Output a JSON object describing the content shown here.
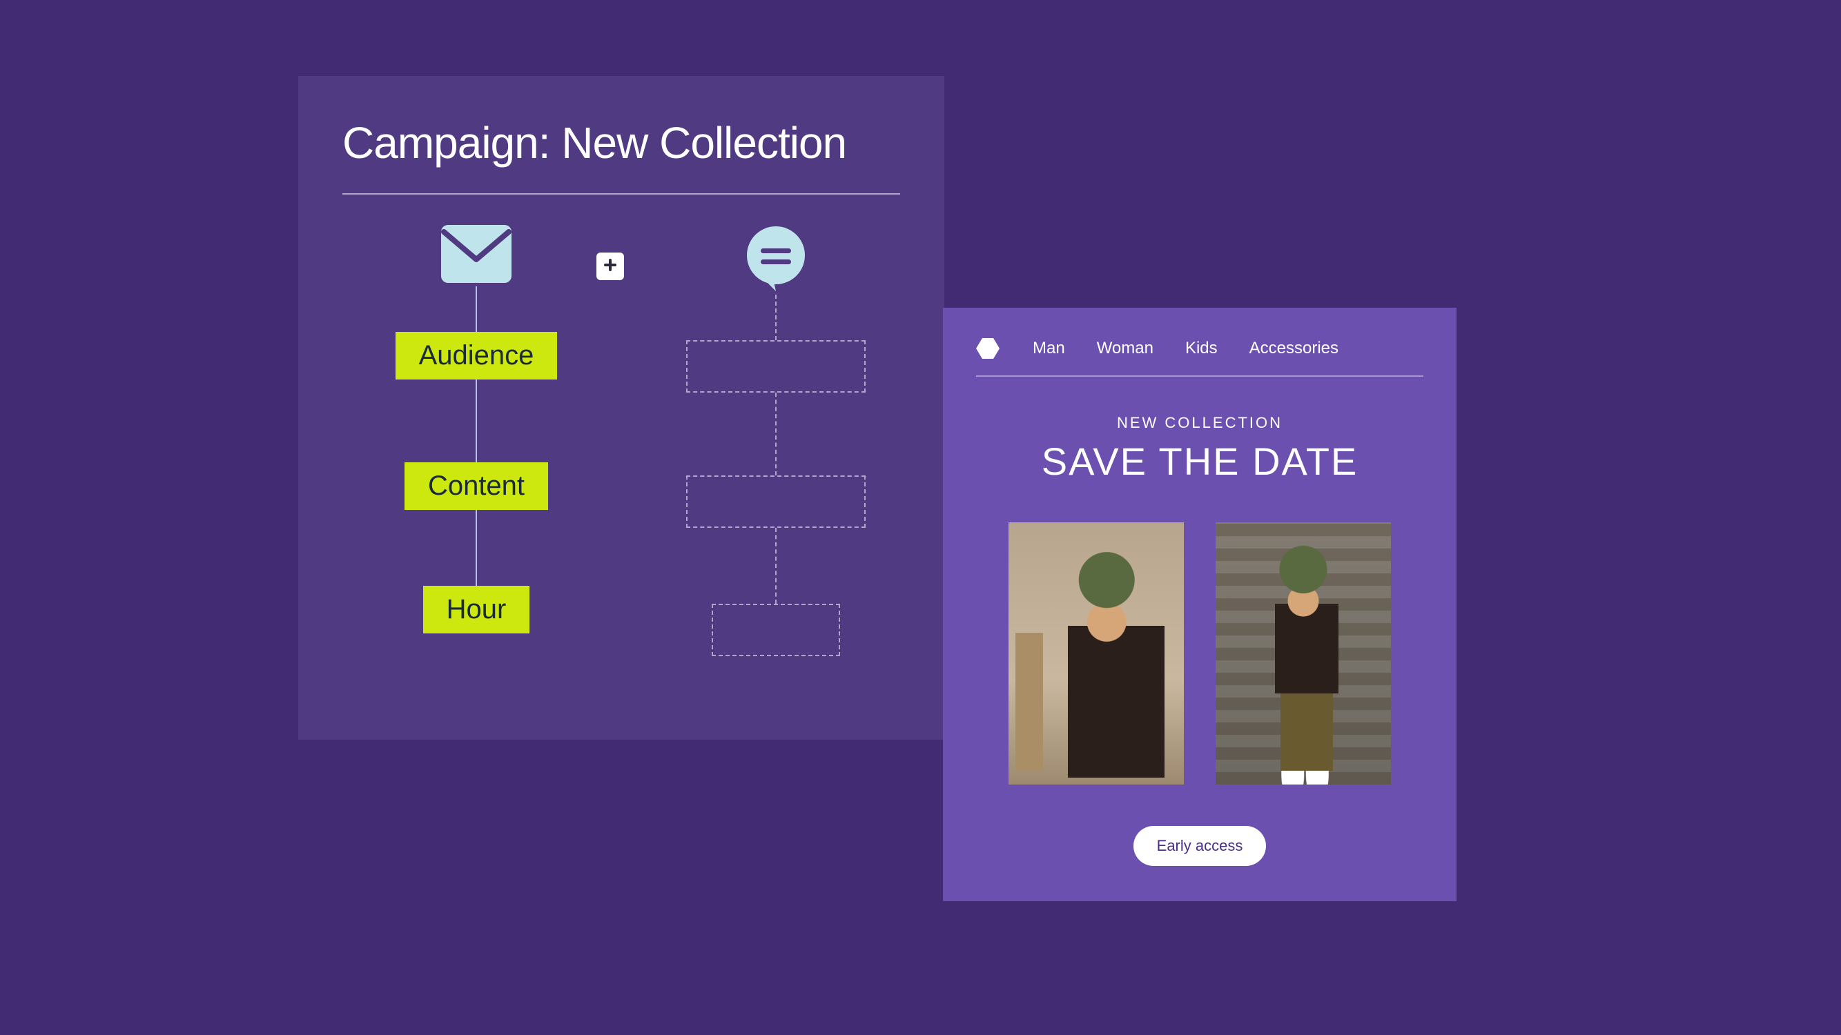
{
  "colors": {
    "bg": "#432b74",
    "panel": "#503a81",
    "preview": "#6b50af",
    "accent_icon": "#bfe4ec",
    "accent_chip": "#cce80f",
    "cta_bg": "#ffffff",
    "cta_text": "#4a2f86"
  },
  "campaign": {
    "title": "Campaign: New Collection",
    "steps": [
      {
        "label": "Audience"
      },
      {
        "label": "Content"
      },
      {
        "label": "Hour"
      }
    ],
    "icons": {
      "left_channel": "mail-icon",
      "right_channel": "chat-icon",
      "plus": "plus-icon"
    }
  },
  "preview": {
    "nav": [
      "Man",
      "Woman",
      "Kids",
      "Accessories"
    ],
    "eyebrow": "NEW COLLECTION",
    "headline": "SAVE THE DATE",
    "cta": "Early access",
    "images": [
      {
        "alt": "Model in dark jacket with backpack near storefront"
      },
      {
        "alt": "Model standing on pedestrian bridge walkway"
      }
    ]
  }
}
